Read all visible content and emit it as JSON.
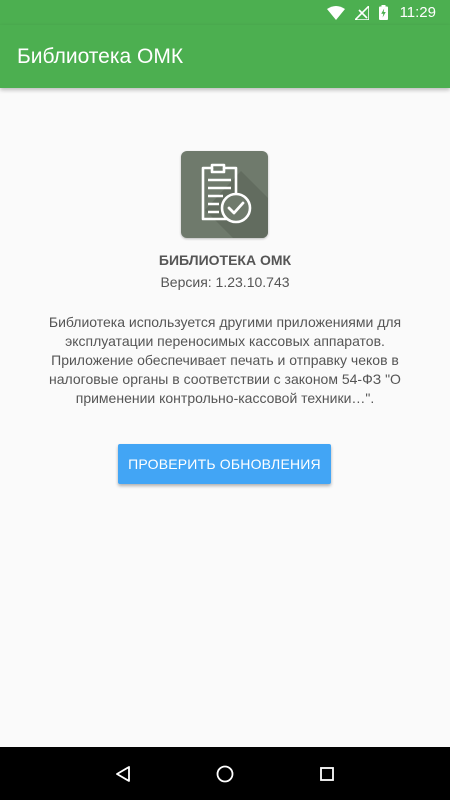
{
  "status_bar": {
    "time": "11:29",
    "icons": [
      "wifi-icon",
      "signal-icon",
      "battery-charging-icon"
    ]
  },
  "app_bar": {
    "title": "Библиотека ОМК",
    "color": "#4caf50"
  },
  "about": {
    "icon": "clipboard-check-icon",
    "name": "БИБЛИОТЕКА ОМК",
    "version_line": "Версия: 1.23.10.743",
    "description": "Библиотека используется другими приложениями для эксплуатации переносимых кассовых аппаратов. Приложение обеспечивает печать и отправку чеков в налоговые органы в соответствии с законом 54-ФЗ \"О применении контрольно-кассовой техники…\".",
    "check_updates_label": "ПРОВЕРИТЬ ОБНОВЛЕНИЯ",
    "button_color": "#42a5f5"
  },
  "nav_bar": {
    "buttons": [
      "back-icon",
      "home-icon",
      "recents-icon"
    ]
  }
}
